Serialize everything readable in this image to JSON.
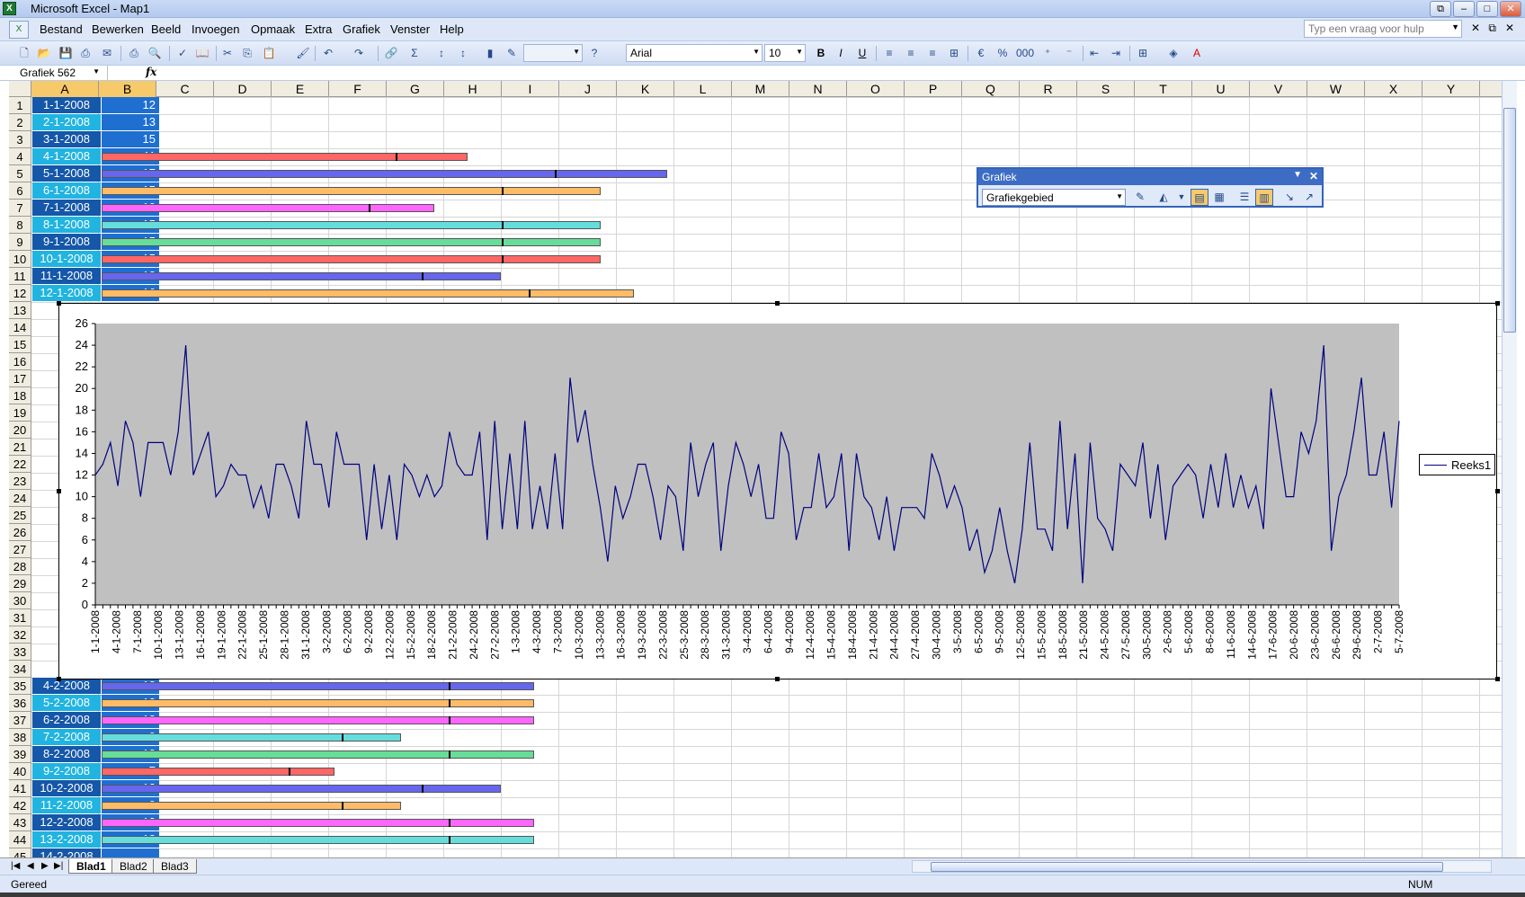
{
  "window": {
    "title": "Microsoft Excel - Map1"
  },
  "menu": [
    "Bestand",
    "Bewerken",
    "Beeld",
    "Invoegen",
    "Opmaak",
    "Extra",
    "Grafiek",
    "Venster",
    "Help"
  ],
  "help_placeholder": "Typ een vraag voor hulp",
  "font": {
    "name": "Arial",
    "size": "10"
  },
  "namebox": "Grafiek 562",
  "columns": [
    "A",
    "B",
    "C",
    "D",
    "E",
    "F",
    "G",
    "H",
    "I",
    "J",
    "K",
    "L",
    "M",
    "N",
    "O",
    "P",
    "Q",
    "R",
    "S",
    "T",
    "U",
    "V",
    "W",
    "X",
    "Y"
  ],
  "rows_visible": [
    "1",
    "2",
    "3",
    "4",
    "5",
    "6",
    "7",
    "8",
    "9",
    "10",
    "11",
    "12",
    "13",
    "14",
    "15",
    "16",
    "17",
    "18",
    "19",
    "20",
    "21",
    "22",
    "23",
    "24",
    "25",
    "26",
    "27",
    "28",
    "29",
    "30",
    "31",
    "32",
    "33",
    "34",
    "35",
    "36",
    "37",
    "38",
    "39",
    "40",
    "41",
    "42",
    "43",
    "44",
    "45"
  ],
  "cells": [
    {
      "a": "1-1-2008",
      "b": "12"
    },
    {
      "a": "2-1-2008",
      "b": "13"
    },
    {
      "a": "3-1-2008",
      "b": "15"
    },
    {
      "a": "4-1-2008",
      "b": "11"
    },
    {
      "a": "5-1-2008",
      "b": "17"
    },
    {
      "a": "6-1-2008",
      "b": "15"
    },
    {
      "a": "7-1-2008",
      "b": "10"
    },
    {
      "a": "8-1-2008",
      "b": "15"
    },
    {
      "a": "9-1-2008",
      "b": "15"
    },
    {
      "a": "10-1-2008",
      "b": "15"
    },
    {
      "a": "11-1-2008",
      "b": "12"
    },
    {
      "a": "12-1-2008",
      "b": "16"
    },
    {
      "a": "4-2-2008",
      "b": "13"
    },
    {
      "a": "5-2-2008",
      "b": "13"
    },
    {
      "a": "6-2-2008",
      "b": "13"
    },
    {
      "a": "7-2-2008",
      "b": "9"
    },
    {
      "a": "8-2-2008",
      "b": "13"
    },
    {
      "a": "9-2-2008",
      "b": "7"
    },
    {
      "a": "10-2-2008",
      "b": "12"
    },
    {
      "a": "11-2-2008",
      "b": "9"
    },
    {
      "a": "12-2-2008",
      "b": "13"
    },
    {
      "a": "13-2-2008",
      "b": "13"
    },
    {
      "a": "14-2-2008",
      "b": ""
    }
  ],
  "row_bar_colors": [
    "#ff66ff",
    "#66dddd",
    "#66dd99",
    "#ff6666",
    "#6666ee",
    "#ffbb66",
    "#ff66ff",
    "#66dddd",
    "#66dd99",
    "#ff6666",
    "#6666ee",
    "#ffbb66"
  ],
  "chart_data": {
    "type": "line",
    "title": "",
    "xlabel": "",
    "ylabel": "",
    "ylim": [
      0,
      26
    ],
    "yticks": [
      0,
      2,
      4,
      6,
      8,
      10,
      12,
      14,
      16,
      18,
      20,
      22,
      24,
      26
    ],
    "plot_background": "#c0c0c0",
    "line_color": "#000080",
    "legend_position": "right",
    "x_tick_labels": [
      "1-1-2008",
      "4-1-2008",
      "7-1-2008",
      "10-1-2008",
      "13-1-2008",
      "16-1-2008",
      "19-1-2008",
      "22-1-2008",
      "25-1-2008",
      "28-1-2008",
      "31-1-2008",
      "3-2-2008",
      "6-2-2008",
      "9-2-2008",
      "12-2-2008",
      "15-2-2008",
      "18-2-2008",
      "21-2-2008",
      "24-2-2008",
      "27-2-2008",
      "1-3-2008",
      "4-3-2008",
      "7-3-2008",
      "10-3-2008",
      "13-3-2008",
      "16-3-2008",
      "19-3-2008",
      "22-3-2008",
      "25-3-2008",
      "28-3-2008",
      "31-3-2008",
      "3-4-2008",
      "6-4-2008",
      "9-4-2008",
      "12-4-2008",
      "15-4-2008",
      "18-4-2008",
      "21-4-2008",
      "24-4-2008",
      "27-4-2008",
      "30-4-2008",
      "3-5-2008",
      "6-5-2008",
      "9-5-2008",
      "12-5-2008",
      "15-5-2008",
      "18-5-2008",
      "21-5-2008",
      "24-5-2008",
      "27-5-2008",
      "30-5-2008",
      "2-6-2008",
      "5-6-2008",
      "8-6-2008",
      "11-6-2008",
      "14-6-2008",
      "17-6-2008",
      "20-6-2008",
      "23-6-2008",
      "26-6-2008",
      "29-6-2008",
      "2-7-2008",
      "5-7-2008"
    ],
    "series": [
      {
        "name": "Reeks1",
        "values": [
          12,
          13,
          15,
          11,
          17,
          15,
          10,
          15,
          15,
          15,
          12,
          16,
          24,
          12,
          14,
          16,
          10,
          11,
          13,
          12,
          12,
          9,
          11,
          8,
          13,
          13,
          11,
          8,
          17,
          13,
          13,
          9,
          16,
          13,
          13,
          13,
          6,
          13,
          7,
          12,
          6,
          13,
          12,
          10,
          12,
          10,
          11,
          16,
          13,
          12,
          12,
          16,
          6,
          17,
          7,
          14,
          7,
          17,
          7,
          11,
          7,
          14,
          7,
          21,
          15,
          18,
          13,
          9,
          4,
          11,
          8,
          10,
          13,
          13,
          10,
          6,
          11,
          10,
          5,
          15,
          10,
          13,
          15,
          5,
          11,
          15,
          13,
          10,
          13,
          8,
          8,
          16,
          14,
          6,
          9,
          9,
          14,
          9,
          10,
          14,
          5,
          14,
          10,
          9,
          6,
          10,
          5,
          9,
          9,
          9,
          8,
          14,
          12,
          9,
          11,
          9,
          5,
          7,
          3,
          5,
          9,
          5,
          2,
          7,
          15,
          7,
          7,
          5,
          17,
          7,
          14,
          2,
          15,
          8,
          7,
          5,
          13,
          12,
          11,
          15,
          8,
          13,
          6,
          11,
          12,
          13,
          12,
          8,
          13,
          9,
          14,
          9,
          12,
          9,
          11,
          7,
          20,
          15,
          10,
          10,
          16,
          14,
          17,
          24,
          5,
          10,
          12,
          16,
          21,
          12,
          12,
          16,
          9,
          17
        ]
      }
    ]
  },
  "legend_label": "Reeks1",
  "floating_toolbar": {
    "title": "Grafiek",
    "selected": "Grafiekgebied"
  },
  "sheets": [
    "Blad1",
    "Blad2",
    "Blad3"
  ],
  "status": {
    "left": "Gereed",
    "num": "NUM"
  }
}
